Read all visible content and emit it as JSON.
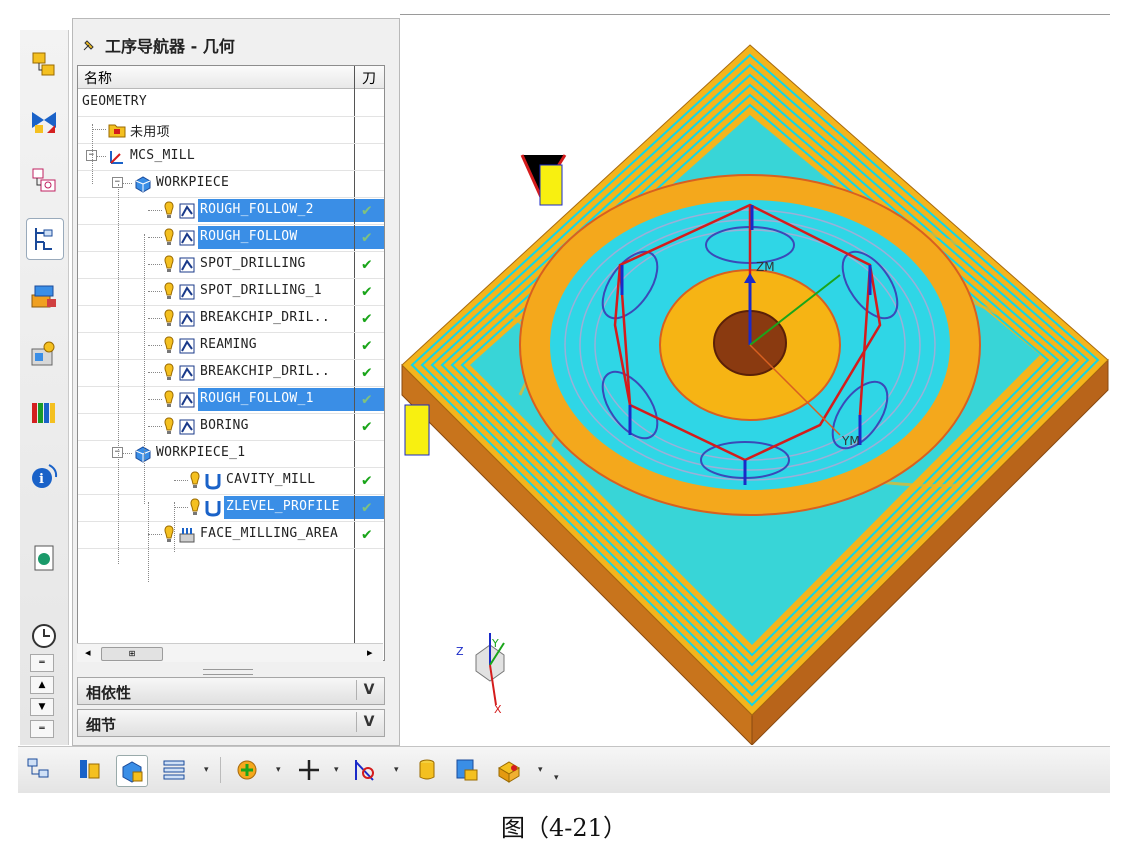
{
  "navigator": {
    "title": "工序导航器 - 几何",
    "columns": {
      "name": "名称",
      "tool": "刀"
    },
    "rows": [
      {
        "label": "GEOMETRY",
        "indent": 0,
        "selected": false,
        "check": ""
      },
      {
        "label": "未用项",
        "indent": 1,
        "selected": false,
        "check": ""
      },
      {
        "label": "MCS_MILL",
        "indent": 1,
        "selected": false,
        "check": ""
      },
      {
        "label": "WORKPIECE",
        "indent": 2,
        "selected": false,
        "check": ""
      },
      {
        "label": "ROUGH_FOLLOW_2",
        "indent": 3,
        "selected": true,
        "check": "✔"
      },
      {
        "label": "ROUGH_FOLLOW",
        "indent": 3,
        "selected": true,
        "check": "✔"
      },
      {
        "label": "SPOT_DRILLING",
        "indent": 3,
        "selected": false,
        "check": "✔"
      },
      {
        "label": "SPOT_DRILLING_1",
        "indent": 3,
        "selected": false,
        "check": "✔"
      },
      {
        "label": "BREAKCHIP_DRIL..",
        "indent": 3,
        "selected": false,
        "check": "✔"
      },
      {
        "label": "REAMING",
        "indent": 3,
        "selected": false,
        "check": "✔"
      },
      {
        "label": "BREAKCHIP_DRIL..",
        "indent": 3,
        "selected": false,
        "check": "✔"
      },
      {
        "label": "ROUGH_FOLLOW_1",
        "indent": 3,
        "selected": true,
        "check": "✔"
      },
      {
        "label": "BORING",
        "indent": 3,
        "selected": false,
        "check": "✔"
      },
      {
        "label": "WORKPIECE_1",
        "indent": 2,
        "selected": false,
        "check": ""
      },
      {
        "label": "CAVITY_MILL",
        "indent": 3,
        "selected": false,
        "check": "✔"
      },
      {
        "label": "ZLEVEL_PROFILE",
        "indent": 3,
        "selected": true,
        "check": "✔"
      },
      {
        "label": "FACE_MILLING_AREA",
        "indent": 2,
        "selected": false,
        "check": "✔"
      }
    ],
    "sections": [
      {
        "title": "相依性"
      },
      {
        "title": "细节"
      }
    ],
    "scroll_thumb": "⊞"
  },
  "viewport": {
    "axis_label_zm": "ZM",
    "axis_label_ym": "YM",
    "triad": {
      "x": "X",
      "y": "Y",
      "z": "Z"
    }
  },
  "caption": "图（4-21）",
  "colors": {
    "selection": "#3a8ee6",
    "toolpath": "#12d6e6",
    "part": "#f4b51c",
    "base": "#c8741c",
    "check": "#1aa51a"
  }
}
